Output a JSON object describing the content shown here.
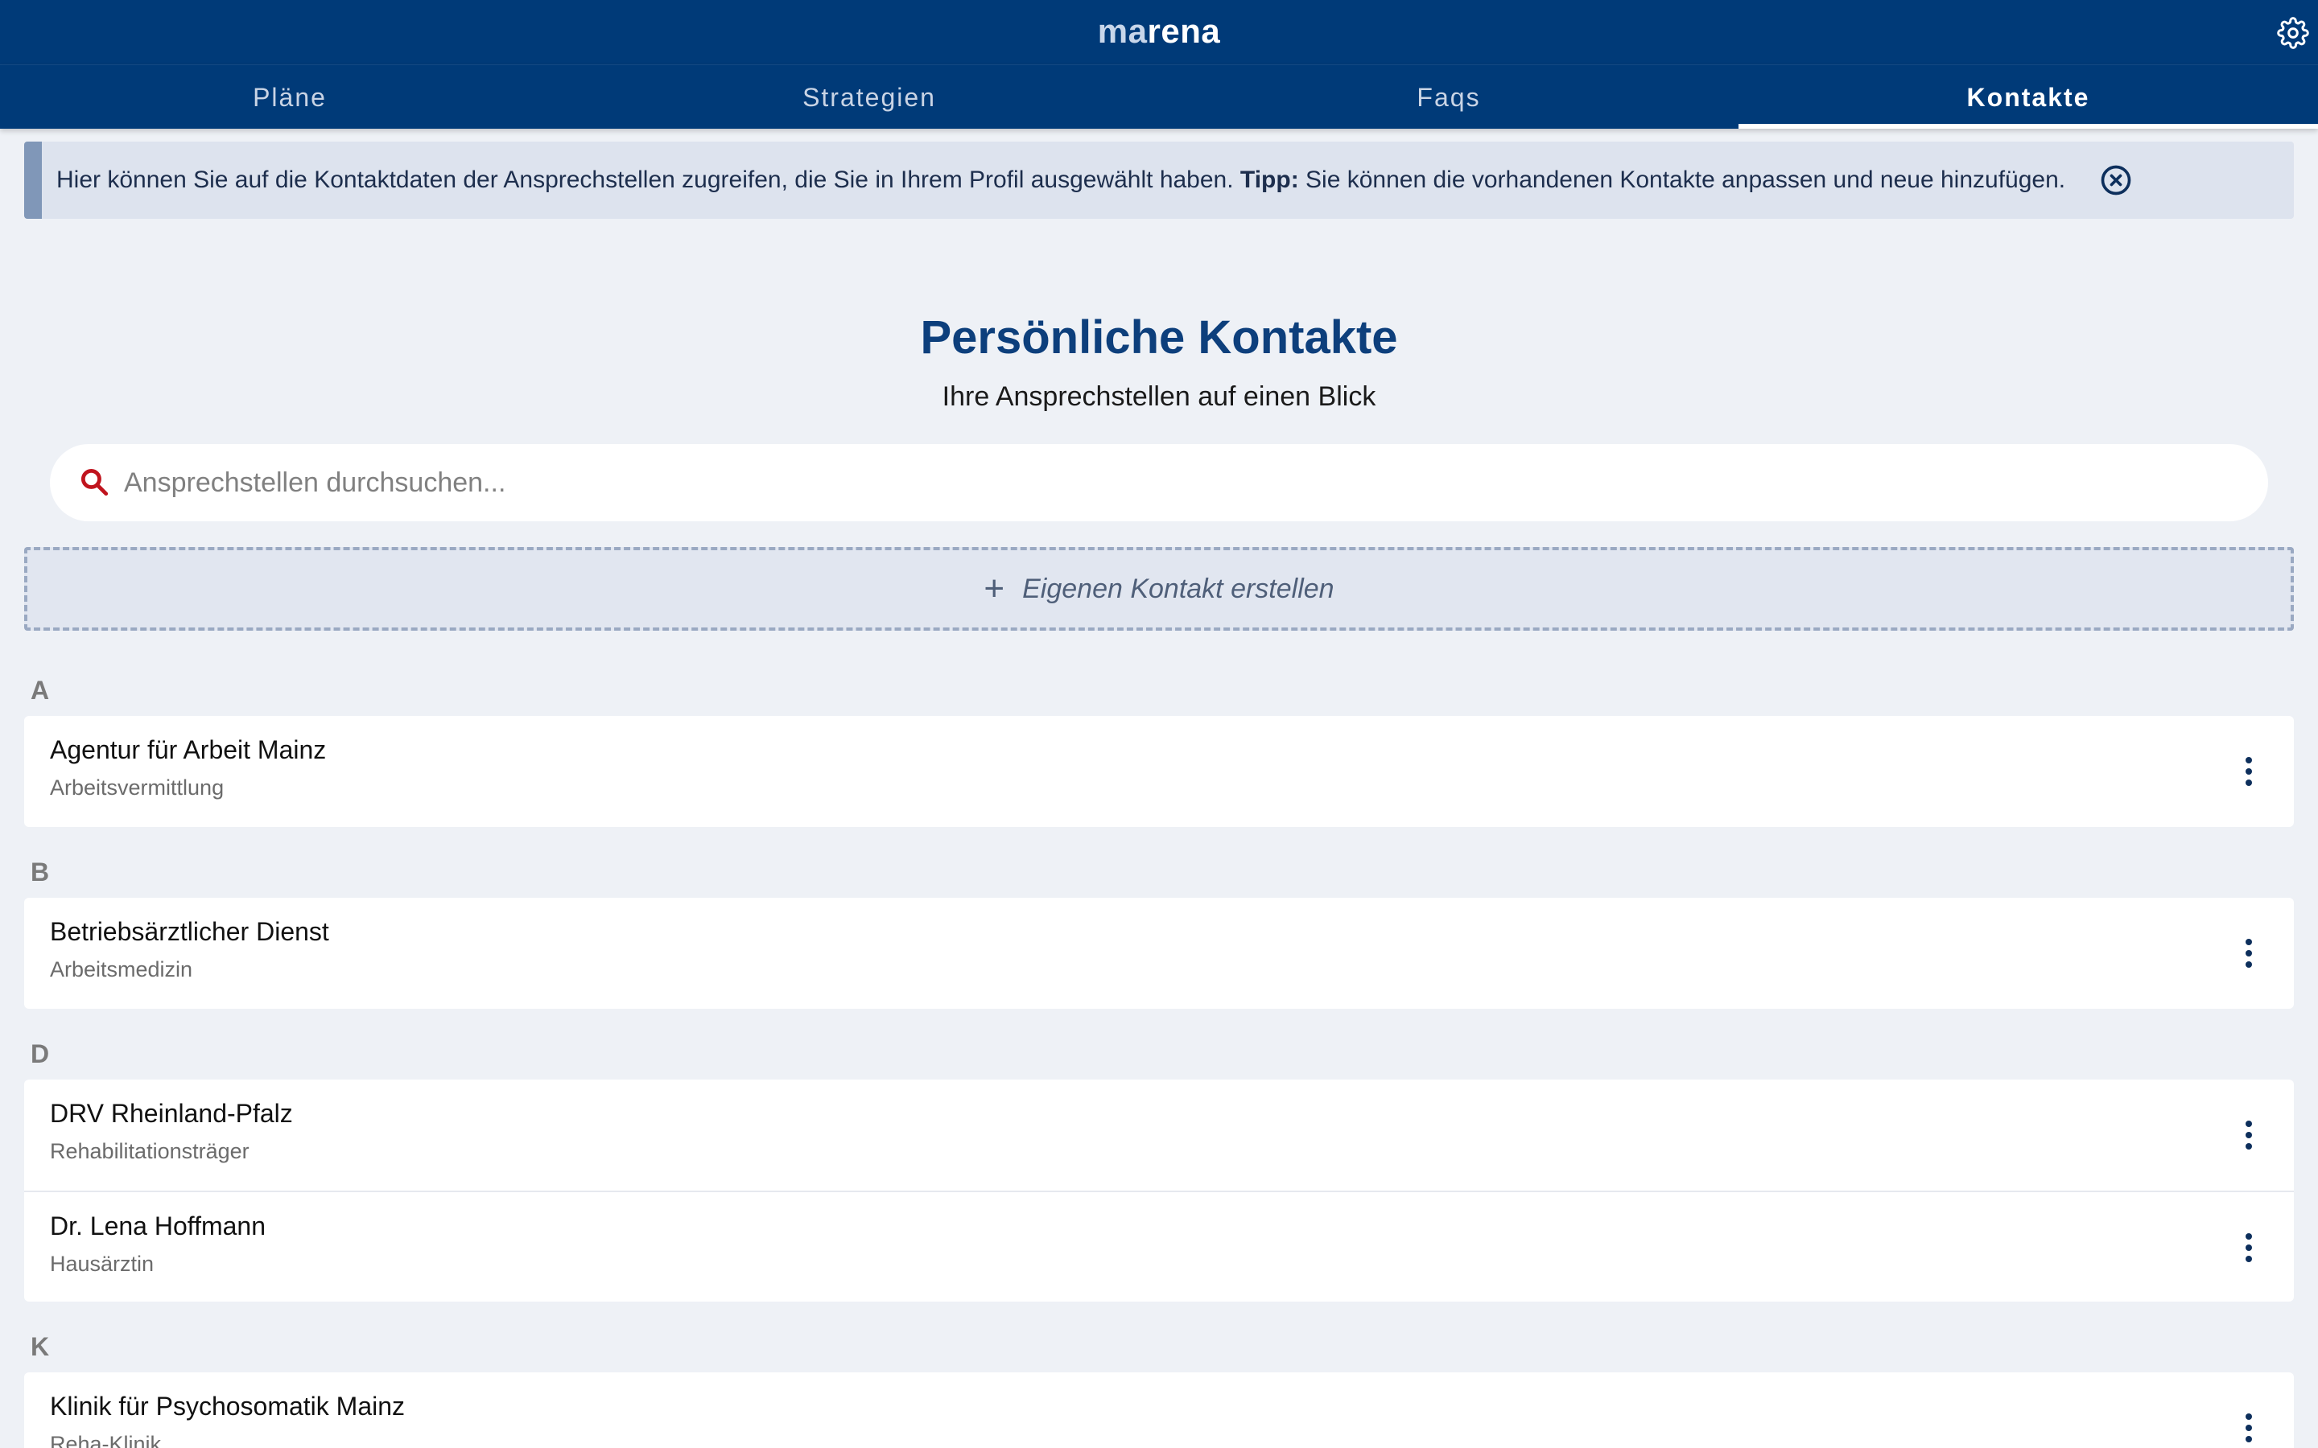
{
  "app": {
    "logo_part1": "ma",
    "logo_part2": "rena"
  },
  "tabs": [
    {
      "label": "Pläne",
      "active": false
    },
    {
      "label": "Strategien",
      "active": false
    },
    {
      "label": "Faqs",
      "active": false
    },
    {
      "label": "Kontakte",
      "active": true
    }
  ],
  "info": {
    "text": "Hier können Sie auf die Kontaktdaten der Ansprechstellen zugreifen, die Sie in Ihrem Profil ausgewählt haben.",
    "tip_label": "Tipp:",
    "tip_text": "Sie können die vorhandenen Kontakte anpassen und neue hinzufügen."
  },
  "header": {
    "title": "Persönliche Kontakte",
    "subtitle": "Ihre Ansprechstellen auf einen Blick"
  },
  "search": {
    "placeholder": "Ansprechstellen durchsuchen..."
  },
  "create_button": {
    "plus": "+",
    "label": "Eigenen Kontakt erstellen"
  },
  "sections": [
    {
      "letter": "A",
      "contacts": [
        {
          "name": "Agentur für Arbeit Mainz",
          "type": "Arbeitsvermittlung"
        }
      ]
    },
    {
      "letter": "B",
      "contacts": [
        {
          "name": "Betriebsärztlicher Dienst",
          "type": "Arbeitsmedizin"
        }
      ]
    },
    {
      "letter": "D",
      "contacts": [
        {
          "name": "DRV Rheinland-Pfalz",
          "type": "Rehabilitationsträger"
        },
        {
          "name": "Dr. Lena Hoffmann",
          "type": "Hausärztin"
        }
      ]
    },
    {
      "letter": "K",
      "contacts": [
        {
          "name": "Klinik für Psychosomatik Mainz",
          "type": "Reha-Klinik"
        }
      ]
    }
  ],
  "colors": {
    "header_bg": "#003a78",
    "accent_title": "#0d3f7c",
    "search_icon": "#c0141e",
    "page_bg": "#eef1f6"
  },
  "icons": {
    "settings": "gear-icon",
    "close": "close-circle-icon",
    "search": "search-icon",
    "menu": "more-vertical-icon"
  }
}
